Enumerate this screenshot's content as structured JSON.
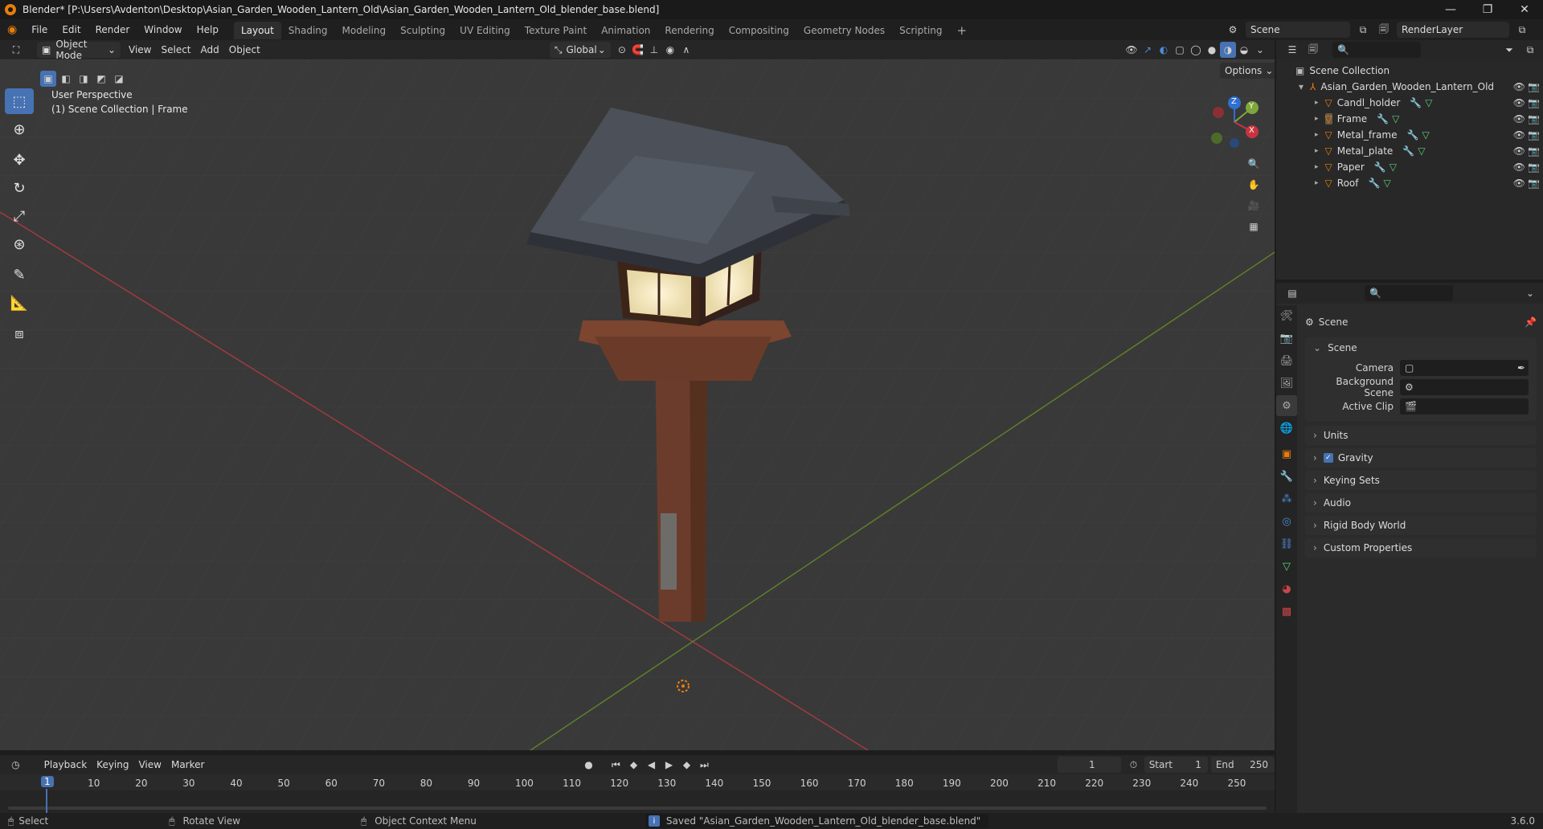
{
  "window": {
    "title": "Blender* [P:\\Users\\Avdenton\\Desktop\\Asian_Garden_Wooden_Lantern_Old\\Asian_Garden_Wooden_Lantern_Old_blender_base.blend]"
  },
  "menus": [
    "File",
    "Edit",
    "Render",
    "Window",
    "Help"
  ],
  "workspaces": [
    "Layout",
    "Shading",
    "Modeling",
    "Sculpting",
    "UV Editing",
    "Texture Paint",
    "Animation",
    "Rendering",
    "Compositing",
    "Geometry Nodes",
    "Scripting"
  ],
  "scene_name": "Scene",
  "view_layer": "RenderLayer",
  "viewport_header": {
    "mode": "Object Mode",
    "menus": [
      "View",
      "Select",
      "Add",
      "Object"
    ],
    "orientation": "Global",
    "options": "Options"
  },
  "viewport_info": {
    "line1": "User Perspective",
    "line2": "(1) Scene Collection | Frame"
  },
  "gizmo": {
    "z": "Z",
    "y": "Y",
    "x": "X"
  },
  "outliner": {
    "root": "Scene Collection",
    "collection": "Asian_Garden_Wooden_Lantern_Old",
    "objects": [
      "Candl_holder",
      "Frame",
      "Metal_frame",
      "Metal_plate",
      "Paper",
      "Roof"
    ]
  },
  "properties": {
    "context": "Scene",
    "section": "Scene",
    "fields": [
      {
        "label": "Camera",
        "value": ""
      },
      {
        "label": "Background Scene",
        "value": ""
      },
      {
        "label": "Active Clip",
        "value": ""
      }
    ],
    "panels": [
      "Units",
      "Gravity",
      "Keying Sets",
      "Audio",
      "Rigid Body World",
      "Custom Properties"
    ],
    "gravity_checked": true
  },
  "timeline": {
    "menus": [
      "Playback",
      "Keying",
      "View",
      "Marker"
    ],
    "current_frame": "1",
    "start_label": "Start",
    "start": "1",
    "end_label": "End",
    "end": "250",
    "ticks": [
      "1",
      "10",
      "20",
      "30",
      "40",
      "50",
      "60",
      "70",
      "80",
      "90",
      "100",
      "110",
      "120",
      "130",
      "140",
      "150",
      "160",
      "170",
      "180",
      "190",
      "200",
      "210",
      "220",
      "230",
      "240",
      "250"
    ]
  },
  "status": {
    "select": "Select",
    "rotate": "Rotate View",
    "context_menu": "Object Context Menu",
    "message": "Saved \"Asian_Garden_Wooden_Lantern_Old_blender_base.blend\"",
    "version": "3.6.0"
  },
  "colors": {
    "accent": "#4772b3",
    "x_axis": "#c7343f",
    "y_axis": "#7fa63a",
    "z_axis": "#2f6fd1",
    "orange": "#e87d0d"
  }
}
